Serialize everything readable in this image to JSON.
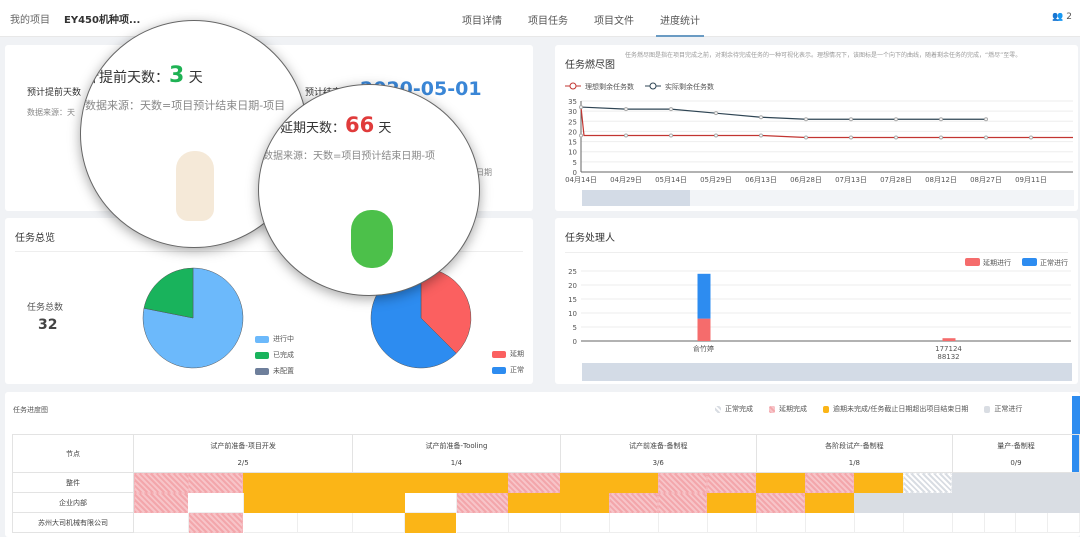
{
  "header": {
    "breadcrumb_root": "我的项目",
    "project": "EY450机种项...",
    "tabs": [
      {
        "label": "项目详情"
      },
      {
        "label": "项目任务"
      },
      {
        "label": "项目文件"
      },
      {
        "label": "进度统计",
        "active": true
      }
    ],
    "member_count": "2",
    "member_icon": "users-icon"
  },
  "summary": {
    "advance_label_small": "预计提前天数",
    "source_small": "数据来源：天",
    "end_label": "预计结束日期",
    "end_date": "2020-05-01",
    "end_note": "日期",
    "latest_note": "最晚的日期",
    "advance": {
      "label": "计提前天数：",
      "value": "3",
      "unit": "天",
      "source": "数据来源：天数=项目预计结束日期-项目"
    },
    "delay": {
      "label": "计延期天数：",
      "value": "66",
      "unit": "天",
      "source": "数据来源：天数=项目预计结束日期-项"
    }
  },
  "burndown": {
    "title": "任务燃尽图",
    "desc": "任务燃尽图是指在项目完成之前，对剩余待完成任务的一种可视化表示。理想情况下，该图标是一个向下的曲线，随着剩余任务的完成，“燃尽”至零。",
    "chart_data": {
      "type": "line",
      "legend_position": "top-left",
      "ylim": [
        0,
        35
      ],
      "yticks": [
        0,
        5,
        10,
        15,
        20,
        25,
        30,
        35
      ],
      "categories": [
        "04月14日",
        "04月29日",
        "05月14日",
        "05月29日",
        "06月13日",
        "06月28日",
        "07月13日",
        "07月28日",
        "08月12日",
        "08月27日",
        "09月11日"
      ],
      "series": [
        {
          "name": "理想剩余任务数",
          "color": "#c23531",
          "values": [
            18,
            18,
            18,
            18,
            18,
            17,
            17,
            17,
            17,
            17,
            17
          ]
        },
        {
          "name": "实际剩余任务数",
          "color": "#2f4554",
          "values": [
            32,
            31,
            31,
            29,
            27,
            26,
            26,
            26,
            26,
            26,
            null
          ]
        }
      ]
    }
  },
  "overview": {
    "title": "任务总览",
    "total_label": "任务总数",
    "total": "32",
    "status_pie": {
      "type": "pie",
      "slices": [
        {
          "label": "进行中",
          "value": 25,
          "color": "#6cb9fb"
        },
        {
          "label": "已完成",
          "value": 7,
          "color": "#19b35c"
        },
        {
          "label": "未配置",
          "value": 0,
          "color": "#6e7f9b"
        }
      ]
    },
    "delay_pie": {
      "type": "pie",
      "slices": [
        {
          "label": "延期",
          "value": 12,
          "color": "#fb6060"
        },
        {
          "label": "正常",
          "value": 20,
          "color": "#2d8cf0"
        }
      ]
    }
  },
  "handlers": {
    "title": "任务处理人",
    "chart_data": {
      "type": "bar",
      "stacked": true,
      "legend_position": "top-right",
      "ylim": [
        0,
        25
      ],
      "yticks": [
        0,
        5,
        10,
        15,
        20,
        25
      ],
      "categories": [
        "俞竹婷",
        "177124\n88132"
      ],
      "series": [
        {
          "name": "延期进行",
          "color": "#f56c6c",
          "values": [
            8,
            1
          ]
        },
        {
          "name": "正常进行",
          "color": "#2d8cf0",
          "values": [
            16,
            0
          ]
        }
      ]
    }
  },
  "progress": {
    "title": "任务进度图",
    "legend": [
      {
        "label": "正常完成",
        "type": "ghatch"
      },
      {
        "label": "延期完成",
        "type": "hatch"
      },
      {
        "label": "逾期未完成/任务截止日期超出项目结束日期",
        "type": "or"
      },
      {
        "label": "正常进行",
        "type": "gr"
      }
    ],
    "node_header": "节点",
    "stages": [
      {
        "name": "试产前准备-项目开发",
        "count": "2/5"
      },
      {
        "name": "试产前准备-Tooling",
        "count": "1/4"
      },
      {
        "name": "试产前准备-备制程",
        "count": "3/6"
      },
      {
        "name": "各阶段试产-备制程",
        "count": "1/8"
      },
      {
        "name": "量产-备制程",
        "count": "0/9"
      }
    ],
    "rows": [
      {
        "name": "整件",
        "cells": [
          "hatch",
          "hatch",
          "or",
          "or",
          "or",
          "or",
          "or",
          "hatch",
          "or",
          "or",
          "hatch",
          "hatch",
          "or",
          "hatch",
          "or",
          "ghatch",
          "gr",
          "gr",
          "gr",
          "gr"
        ]
      },
      {
        "name": "企业内部",
        "cells": [
          "hatch",
          "",
          "or",
          "or",
          "or",
          "",
          "hatch",
          "or",
          "or",
          "hatch",
          "hatch",
          "or",
          "hatch",
          "or",
          "gr",
          "gr",
          "gr",
          "gr",
          "gr",
          "gr"
        ]
      },
      {
        "name": "苏州大司机械有限公司",
        "cells": [
          "",
          "hatch",
          "",
          "",
          "",
          "or",
          "",
          "",
          "",
          "",
          "",
          "",
          "",
          "",
          "",
          "",
          "",
          "",
          "",
          ""
        ]
      }
    ]
  }
}
